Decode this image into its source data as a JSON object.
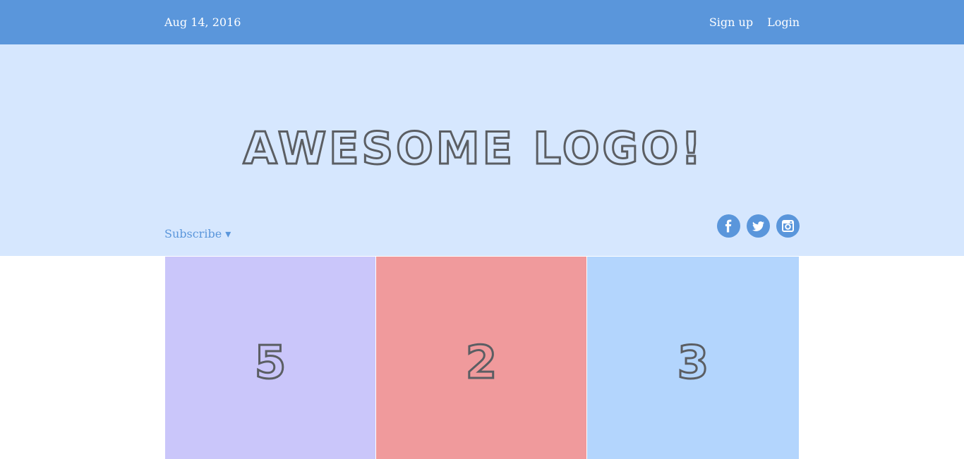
{
  "topbar": {
    "date": "Aug 14, 2016",
    "nav": [
      {
        "label": "Sign up"
      },
      {
        "label": "Login"
      }
    ]
  },
  "header": {
    "logo_text": "AWESOME LOGO!",
    "subscribe_label": "Subscribe ▾",
    "social": [
      {
        "icon": "facebook-icon"
      },
      {
        "icon": "twitter-icon"
      },
      {
        "icon": "instagram-icon"
      }
    ]
  },
  "tiles": [
    {
      "number": "5",
      "color": "#cac6fa"
    },
    {
      "number": "2",
      "color": "#f09a9c"
    },
    {
      "number": "3",
      "color": "#b3d5fd"
    }
  ],
  "colors": {
    "accent": "#5a96db",
    "header_bg": "#d6e7fe",
    "logo_ink": "#5b5e63"
  }
}
